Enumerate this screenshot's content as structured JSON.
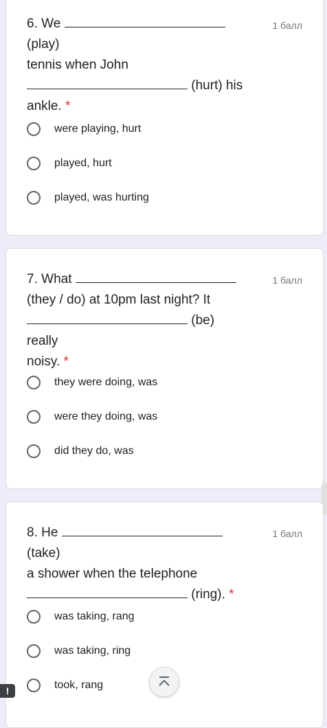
{
  "questions": [
    {
      "number": "6.",
      "pre": "We",
      "after_blank1": "(play)",
      "line2": "tennis when John",
      "after_blank2": "(hurt) his",
      "line4": "ankle.",
      "required": "*",
      "points": "1 балл",
      "options": [
        "were playing, hurt",
        "played, hurt",
        "played, was hurting"
      ]
    },
    {
      "number": "7.",
      "pre": "What",
      "line2": "(they / do) at 10pm last night? It",
      "after_blank2": "(be) really",
      "line4": "noisy.",
      "required": "*",
      "points": "1 балл",
      "options": [
        "they were doing, was",
        "were they doing, was",
        "did they do, was"
      ]
    },
    {
      "number": "8.",
      "pre": "He",
      "after_blank1": "(take)",
      "line2": "a shower when the telephone",
      "after_blank2": "(ring).",
      "required": "*",
      "points": "1 балл",
      "options": [
        "was taking, rang",
        "was taking, ring",
        "took, rang"
      ]
    }
  ],
  "ui": {
    "scroll_top_icon": "chevron-up-double-icon",
    "alert_badge": "!"
  }
}
